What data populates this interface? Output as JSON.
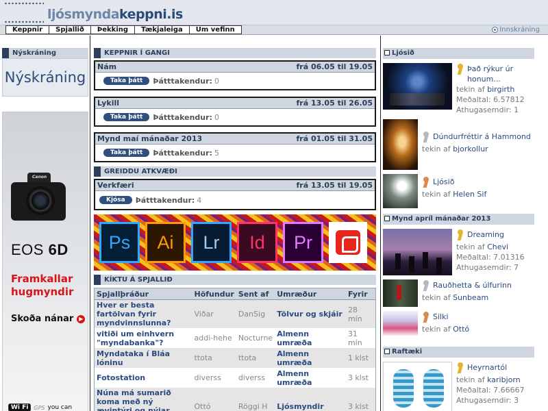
{
  "site": {
    "logo_part1": "ljósmynda",
    "logo_part2": "keppni.is"
  },
  "nav": {
    "items": [
      "Keppnir",
      "Spjallið",
      "Þekking",
      "Tækjaleiga",
      "Um vefinn"
    ],
    "login": "Innskráning"
  },
  "left": {
    "signup_title": "Nýskráning",
    "signup_big": "Nýskráning",
    "ad": {
      "brand": "Canon",
      "model_a": "EOS",
      "model_b": "6D",
      "slogan": "Framkallar hugmyndir",
      "more": "Skoða nánar",
      "wifi": "Wi Fi",
      "gps": "GPS",
      "tail": "you can"
    }
  },
  "middle": {
    "contests_title": "Keppnir í gangi",
    "take_part": "Taka þátt",
    "participants_label": "Þátttakendur:",
    "contests": [
      {
        "name": "Nám",
        "dates": "frá 06.05 til 19.05",
        "count": "0"
      },
      {
        "name": "Lykill",
        "dates": "frá 13.05 til 26.05",
        "count": "0"
      },
      {
        "name": "Mynd maí mánaðar 2013",
        "dates": "frá 01.05 til 31.05",
        "count": "5"
      }
    ],
    "vote_title": "Greiddu atkvæði",
    "vote": {
      "name": "Verkfæri",
      "dates": "frá 13.05 til 19.05",
      "button": "Kjósa",
      "count": "4"
    },
    "adobe": [
      "Ps",
      "Ai",
      "Lr",
      "Id",
      "Pr"
    ],
    "forum_title": "Kíktu á spjallið",
    "forum": {
      "headers": [
        "Spjallþráður",
        "Höfundur",
        "Sent af",
        "Umræður",
        "Fyrir"
      ],
      "rows": [
        {
          "topic": "Hver er besta fartölvan fyrir myndvinnslunna?",
          "author": "Viðar",
          "sent": "DanSig",
          "cat": "Tölvur og skjáir",
          "ago": "28 mín"
        },
        {
          "topic": "vitiði um einhvern \"myndabanka\"?",
          "author": "addi-hehe",
          "sent": "Nocturne",
          "cat": "Almenn umræða",
          "ago": "31 mín"
        },
        {
          "topic": "Myndataka í Bláa lóninu",
          "author": "ttota",
          "sent": "ttota",
          "cat": "Almenn umræða",
          "ago": "1 klst"
        },
        {
          "topic": "Fotostation",
          "author": "diverss",
          "sent": "diverss",
          "cat": "Almenn umræða",
          "ago": "3 klst"
        },
        {
          "topic": "Núna má sumarið koma með ný ævintýri og nýjar ferðir",
          "author": "Ottó",
          "sent": "Röggi H",
          "cat": "Ljósmyndir",
          "ago": "3 klst"
        }
      ]
    }
  },
  "right": {
    "sec1_title": "Ljósið",
    "items1": [
      {
        "title": "Það rýkur úr honum...",
        "by": "birgirth",
        "avg": "6.57812",
        "comments": "1"
      },
      {
        "title": "Dúndurfréttir á Hammond",
        "by": "bjorkollur"
      },
      {
        "title": "Ljósið",
        "by": "Helen Sif"
      }
    ],
    "sec2_title": "Mynd apríl mánaðar 2013",
    "items2": [
      {
        "title": "Dreaming",
        "by": "Chevi",
        "avg": "7.01316",
        "comments": "7"
      },
      {
        "title": "Rauðhetta & úlfurinn",
        "by": "Sunbeam"
      },
      {
        "title": "Silki",
        "by": "Ottó"
      }
    ],
    "sec3_title": "Raftæki",
    "items3": [
      {
        "title": "Heyrnartól",
        "by": "karibjorn",
        "avg": "7.66667",
        "comments": "3"
      }
    ],
    "labels": {
      "by": "tekin af",
      "avg": "Meðaltal:",
      "comments": "Athugasemdir:"
    }
  }
}
